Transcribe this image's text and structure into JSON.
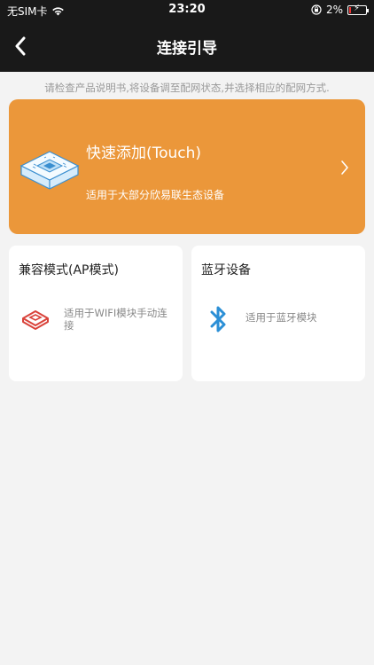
{
  "status_bar": {
    "carrier": "无SIM卡",
    "time": "23:20",
    "battery": "2%"
  },
  "nav": {
    "title": "连接引导"
  },
  "hint": "请检查产品说明书,将设备调至配网状态,并选择相应的配网方式.",
  "quick_add": {
    "title": "快速添加(Touch)",
    "desc": "适用于大部分欣易联生态设备",
    "bg_color": "#eb973a"
  },
  "ap_mode": {
    "title": "兼容模式(AP模式)",
    "desc": "适用于WIFI模块手动连接",
    "icon": "router-icon"
  },
  "bluetooth": {
    "title": "蓝牙设备",
    "desc": "适用于蓝牙模块",
    "icon": "bluetooth-icon"
  },
  "colors": {
    "header_bg": "#191919",
    "page_bg": "#f3f3f3",
    "ap_icon": "#d9423a",
    "bluetooth_icon": "#2b8fd6"
  }
}
